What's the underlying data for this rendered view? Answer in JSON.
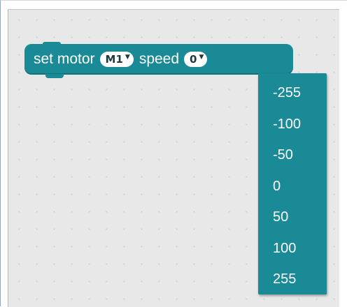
{
  "block": {
    "word1": "set motor",
    "motor_value": "M1",
    "word2": "speed",
    "speed_value": "0",
    "caret_symbol": "▼",
    "color": "#1a8a96"
  },
  "dropdown": {
    "options": [
      "-255",
      "-100",
      "-50",
      "0",
      "50",
      "100",
      "255"
    ]
  },
  "colors": {
    "workspace": "#e8e8e8",
    "block": "#1a8a96",
    "text": "#ffffff"
  }
}
